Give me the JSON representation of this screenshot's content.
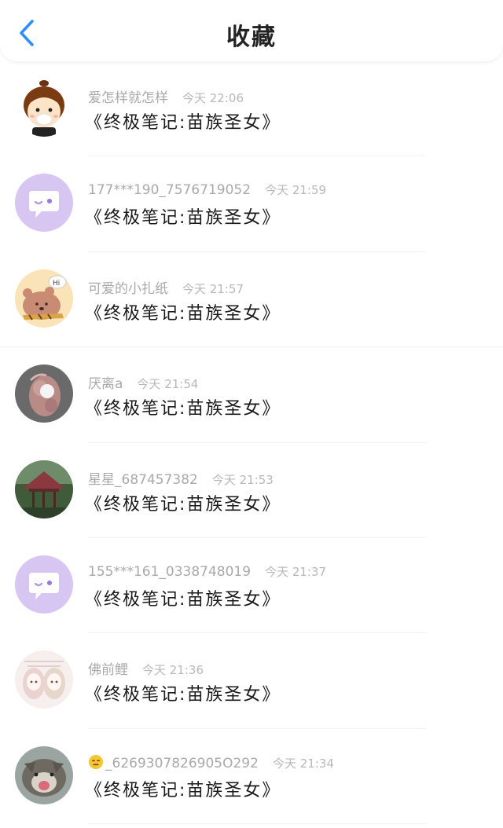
{
  "header": {
    "title": "收藏",
    "accent_color": "#2f8cff"
  },
  "items": [
    {
      "user": "爱怎样就怎样",
      "time": "今天 22:06",
      "title": "《终极笔记:苗族圣女》",
      "avatar": "cartoon-boy-avatar"
    },
    {
      "user": "177***190_7576719052",
      "time": "今天 21:59",
      "title": "《终极笔记:苗族圣女》",
      "avatar": "default-chat-avatar"
    },
    {
      "user": "可爱的小扎纸",
      "time": "今天 21:57",
      "title": "《终极笔记:苗族圣女》",
      "avatar": "bear-avatar"
    },
    {
      "user": "厌离a",
      "time": "今天 21:54",
      "title": "《终极笔记:苗族圣女》",
      "avatar": "plush-doll-avatar"
    },
    {
      "user": "星星_687457382",
      "time": "今天 21:53",
      "title": "《终极笔记:苗族圣女》",
      "avatar": "pavilion-avatar"
    },
    {
      "user": "155***161_0338748019",
      "time": "今天 21:37",
      "title": "《终极笔记:苗族圣女》",
      "avatar": "default-chat-avatar"
    },
    {
      "user": "佛前鲤",
      "time": "今天 21:36",
      "title": "《终极笔记:苗族圣女》",
      "avatar": "anime-girls-avatar"
    },
    {
      "user": "_6269307826905O292",
      "time": "今天 21:34",
      "title": "《终极笔记:苗族圣女》",
      "avatar": "cat-avatar",
      "user_emoji": "expressionless-face-icon"
    }
  ]
}
